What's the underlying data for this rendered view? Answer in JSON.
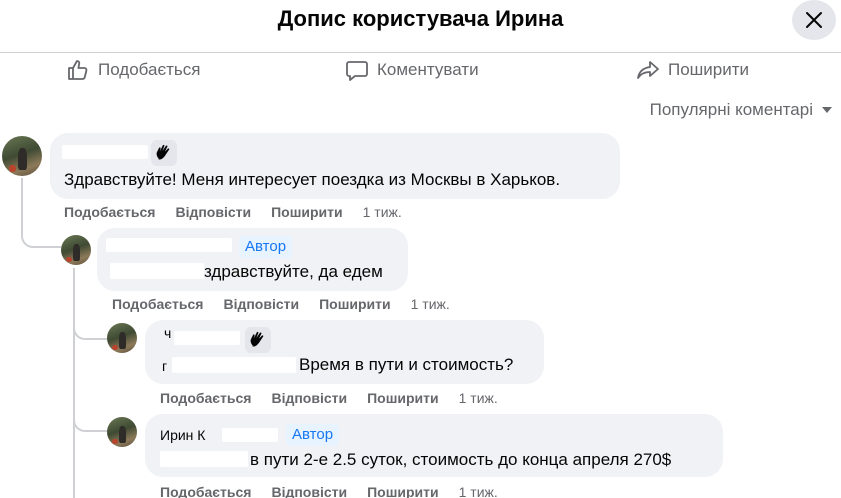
{
  "header": {
    "title": "Допис користувача Ирина",
    "close_icon": "close-icon"
  },
  "actions": {
    "like": "Подобається",
    "comment": "Коментувати",
    "share": "Поширити"
  },
  "sort": {
    "label": "Популярні коментарі"
  },
  "comments": [
    {
      "text": "Здравствуйте! Меня интересует поездка из Москвы в Харьков.",
      "like": "Подобається",
      "reply": "Відповісти",
      "share": "Поширити",
      "time": "1 тиж."
    },
    {
      "badge": "Автор",
      "text": "здравствуйте, да едем",
      "like": "Подобається",
      "reply": "Відповісти",
      "share": "Поширити",
      "time": "1 тиж."
    },
    {
      "name_prefix": "ч",
      "text_prefix": "г",
      "text": "Время в пути и стоимость?",
      "like": "Подобається",
      "reply": "Відповісти",
      "share": "Поширити",
      "time": "1 тиж."
    },
    {
      "name_prefix": "Ирин  К",
      "badge": "Автор",
      "text": "в пути 2-е 2.5 суток, стоимость до конца апреля 270$",
      "like": "Подобається",
      "reply": "Відповісти",
      "share": "Поширити",
      "time": "1 тиж."
    }
  ]
}
